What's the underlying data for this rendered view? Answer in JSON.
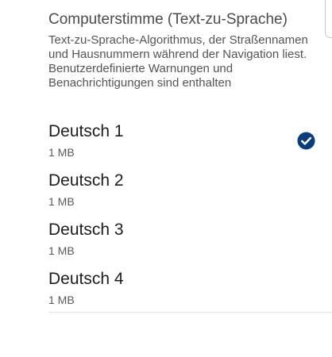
{
  "section": {
    "title": "Computerstimme (Text-zu-Sprache)",
    "description": "Text-zu-Sprache-Algorithmus, der Straßennamen und Hausnummern während der Navigation liest. Benutzerdefinierte Warnungen und Benachrichtigungen sind enthalten"
  },
  "voices": [
    {
      "name": "Deutsch 1",
      "size": "1 MB",
      "selected": true
    },
    {
      "name": "Deutsch 2",
      "size": "1 MB",
      "selected": false
    },
    {
      "name": "Deutsch 3",
      "size": "1 MB",
      "selected": false
    },
    {
      "name": "Deutsch 4",
      "size": "1 MB",
      "selected": false
    }
  ],
  "colors": {
    "accent": "#0b3d7a"
  },
  "icons": {
    "selected": "check-circle-icon"
  }
}
